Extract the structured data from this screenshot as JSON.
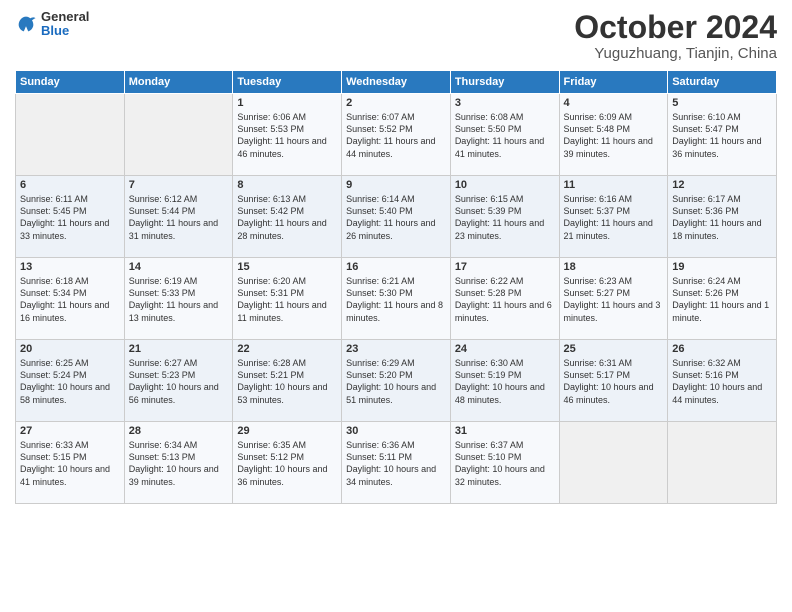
{
  "logo": {
    "general": "General",
    "blue": "Blue"
  },
  "title": "October 2024",
  "location": "Yuguzhuang, Tianjin, China",
  "days_header": [
    "Sunday",
    "Monday",
    "Tuesday",
    "Wednesday",
    "Thursday",
    "Friday",
    "Saturday"
  ],
  "weeks": [
    [
      {
        "day": "",
        "info": ""
      },
      {
        "day": "",
        "info": ""
      },
      {
        "day": "1",
        "info": "Sunrise: 6:06 AM\nSunset: 5:53 PM\nDaylight: 11 hours and 46 minutes."
      },
      {
        "day": "2",
        "info": "Sunrise: 6:07 AM\nSunset: 5:52 PM\nDaylight: 11 hours and 44 minutes."
      },
      {
        "day": "3",
        "info": "Sunrise: 6:08 AM\nSunset: 5:50 PM\nDaylight: 11 hours and 41 minutes."
      },
      {
        "day": "4",
        "info": "Sunrise: 6:09 AM\nSunset: 5:48 PM\nDaylight: 11 hours and 39 minutes."
      },
      {
        "day": "5",
        "info": "Sunrise: 6:10 AM\nSunset: 5:47 PM\nDaylight: 11 hours and 36 minutes."
      }
    ],
    [
      {
        "day": "6",
        "info": "Sunrise: 6:11 AM\nSunset: 5:45 PM\nDaylight: 11 hours and 33 minutes."
      },
      {
        "day": "7",
        "info": "Sunrise: 6:12 AM\nSunset: 5:44 PM\nDaylight: 11 hours and 31 minutes."
      },
      {
        "day": "8",
        "info": "Sunrise: 6:13 AM\nSunset: 5:42 PM\nDaylight: 11 hours and 28 minutes."
      },
      {
        "day": "9",
        "info": "Sunrise: 6:14 AM\nSunset: 5:40 PM\nDaylight: 11 hours and 26 minutes."
      },
      {
        "day": "10",
        "info": "Sunrise: 6:15 AM\nSunset: 5:39 PM\nDaylight: 11 hours and 23 minutes."
      },
      {
        "day": "11",
        "info": "Sunrise: 6:16 AM\nSunset: 5:37 PM\nDaylight: 11 hours and 21 minutes."
      },
      {
        "day": "12",
        "info": "Sunrise: 6:17 AM\nSunset: 5:36 PM\nDaylight: 11 hours and 18 minutes."
      }
    ],
    [
      {
        "day": "13",
        "info": "Sunrise: 6:18 AM\nSunset: 5:34 PM\nDaylight: 11 hours and 16 minutes."
      },
      {
        "day": "14",
        "info": "Sunrise: 6:19 AM\nSunset: 5:33 PM\nDaylight: 11 hours and 13 minutes."
      },
      {
        "day": "15",
        "info": "Sunrise: 6:20 AM\nSunset: 5:31 PM\nDaylight: 11 hours and 11 minutes."
      },
      {
        "day": "16",
        "info": "Sunrise: 6:21 AM\nSunset: 5:30 PM\nDaylight: 11 hours and 8 minutes."
      },
      {
        "day": "17",
        "info": "Sunrise: 6:22 AM\nSunset: 5:28 PM\nDaylight: 11 hours and 6 minutes."
      },
      {
        "day": "18",
        "info": "Sunrise: 6:23 AM\nSunset: 5:27 PM\nDaylight: 11 hours and 3 minutes."
      },
      {
        "day": "19",
        "info": "Sunrise: 6:24 AM\nSunset: 5:26 PM\nDaylight: 11 hours and 1 minute."
      }
    ],
    [
      {
        "day": "20",
        "info": "Sunrise: 6:25 AM\nSunset: 5:24 PM\nDaylight: 10 hours and 58 minutes."
      },
      {
        "day": "21",
        "info": "Sunrise: 6:27 AM\nSunset: 5:23 PM\nDaylight: 10 hours and 56 minutes."
      },
      {
        "day": "22",
        "info": "Sunrise: 6:28 AM\nSunset: 5:21 PM\nDaylight: 10 hours and 53 minutes."
      },
      {
        "day": "23",
        "info": "Sunrise: 6:29 AM\nSunset: 5:20 PM\nDaylight: 10 hours and 51 minutes."
      },
      {
        "day": "24",
        "info": "Sunrise: 6:30 AM\nSunset: 5:19 PM\nDaylight: 10 hours and 48 minutes."
      },
      {
        "day": "25",
        "info": "Sunrise: 6:31 AM\nSunset: 5:17 PM\nDaylight: 10 hours and 46 minutes."
      },
      {
        "day": "26",
        "info": "Sunrise: 6:32 AM\nSunset: 5:16 PM\nDaylight: 10 hours and 44 minutes."
      }
    ],
    [
      {
        "day": "27",
        "info": "Sunrise: 6:33 AM\nSunset: 5:15 PM\nDaylight: 10 hours and 41 minutes."
      },
      {
        "day": "28",
        "info": "Sunrise: 6:34 AM\nSunset: 5:13 PM\nDaylight: 10 hours and 39 minutes."
      },
      {
        "day": "29",
        "info": "Sunrise: 6:35 AM\nSunset: 5:12 PM\nDaylight: 10 hours and 36 minutes."
      },
      {
        "day": "30",
        "info": "Sunrise: 6:36 AM\nSunset: 5:11 PM\nDaylight: 10 hours and 34 minutes."
      },
      {
        "day": "31",
        "info": "Sunrise: 6:37 AM\nSunset: 5:10 PM\nDaylight: 10 hours and 32 minutes."
      },
      {
        "day": "",
        "info": ""
      },
      {
        "day": "",
        "info": ""
      }
    ]
  ]
}
